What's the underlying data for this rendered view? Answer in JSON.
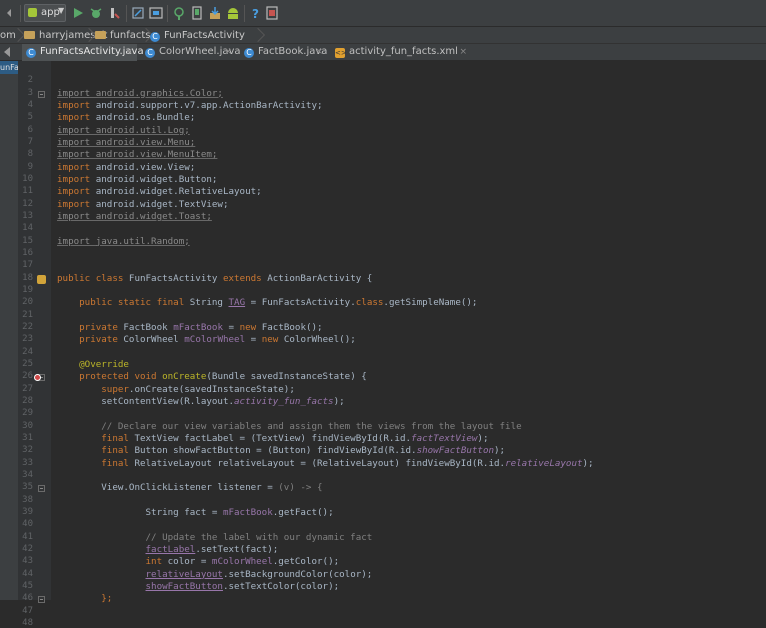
{
  "toolbar": {
    "run_config": "app",
    "icons": [
      "undo-icon",
      "redo-icon",
      "run-icon",
      "debug-icon",
      "stop-icon",
      "attach-debugger-icon",
      "sdk-manager-icon",
      "avd-manager-icon",
      "sync-icon",
      "gradle-icon",
      "android-icon",
      "help-icon",
      "device-monitor-icon"
    ]
  },
  "breadcrumb": {
    "items": [
      "om",
      "harryjamesuk",
      "funfacts",
      "FunFactsActivity"
    ]
  },
  "tabs": [
    {
      "label": "FunFactsActivity.java",
      "active": true,
      "type": "class"
    },
    {
      "label": "ColorWheel.java",
      "active": false,
      "type": "class"
    },
    {
      "label": "FactBook.java",
      "active": false,
      "type": "class"
    },
    {
      "label": "activity_fun_facts.xml",
      "active": false,
      "type": "xml"
    }
  ],
  "tab_close_label": "×",
  "left_strip": {
    "label": "unFa"
  },
  "editor": {
    "lines": [
      {
        "n": "",
        "segs": []
      },
      {
        "n": "2",
        "segs": []
      },
      {
        "n": "3",
        "segs": [
          {
            "t": "import android.graphics.Color;",
            "c": "imp"
          }
        ]
      },
      {
        "n": "4",
        "segs": [
          {
            "t": "import ",
            "c": "kw"
          },
          {
            "t": "android.support.v7.app.ActionBarActivity;",
            "c": ""
          }
        ]
      },
      {
        "n": "5",
        "segs": [
          {
            "t": "import ",
            "c": "kw"
          },
          {
            "t": "android.os.Bundle;",
            "c": ""
          }
        ]
      },
      {
        "n": "6",
        "segs": [
          {
            "t": "import android.util.Log;",
            "c": "imp"
          }
        ]
      },
      {
        "n": "7",
        "segs": [
          {
            "t": "import android.view.Menu;",
            "c": "imp"
          }
        ]
      },
      {
        "n": "8",
        "segs": [
          {
            "t": "import android.view.MenuItem;",
            "c": "imp"
          }
        ]
      },
      {
        "n": "9",
        "segs": [
          {
            "t": "import ",
            "c": "kw"
          },
          {
            "t": "android.view.View;",
            "c": ""
          }
        ]
      },
      {
        "n": "10",
        "segs": [
          {
            "t": "import ",
            "c": "kw"
          },
          {
            "t": "android.widget.Button;",
            "c": ""
          }
        ]
      },
      {
        "n": "11",
        "segs": [
          {
            "t": "import ",
            "c": "kw"
          },
          {
            "t": "android.widget.RelativeLayout;",
            "c": ""
          }
        ]
      },
      {
        "n": "12",
        "segs": [
          {
            "t": "import ",
            "c": "kw"
          },
          {
            "t": "android.widget.TextView;",
            "c": ""
          }
        ]
      },
      {
        "n": "13",
        "segs": [
          {
            "t": "import android.widget.Toast;",
            "c": "imp"
          }
        ]
      },
      {
        "n": "14",
        "segs": []
      },
      {
        "n": "15",
        "segs": [
          {
            "t": "import java.util.Random;",
            "c": "imp"
          }
        ]
      },
      {
        "n": "16",
        "segs": []
      },
      {
        "n": "17",
        "segs": []
      },
      {
        "n": "18",
        "segs": [
          {
            "t": "public class ",
            "c": "kw"
          },
          {
            "t": "FunFactsActivity ",
            "c": ""
          },
          {
            "t": "extends ",
            "c": "kw"
          },
          {
            "t": "ActionBarActivity {",
            "c": ""
          }
        ]
      },
      {
        "n": "19",
        "segs": []
      },
      {
        "n": "20",
        "segs": [
          {
            "t": "    public static final ",
            "c": "kw"
          },
          {
            "t": "String ",
            "c": ""
          },
          {
            "t": "TAG",
            "c": "ulfld"
          },
          {
            "t": " = FunFactsActivity.",
            "c": ""
          },
          {
            "t": "class",
            "c": "kw"
          },
          {
            "t": ".getSimpleName();",
            "c": ""
          }
        ]
      },
      {
        "n": "21",
        "segs": []
      },
      {
        "n": "22",
        "segs": [
          {
            "t": "    private ",
            "c": "kw"
          },
          {
            "t": "FactBook ",
            "c": ""
          },
          {
            "t": "mFactBook",
            "c": "fld"
          },
          {
            "t": " = ",
            "c": ""
          },
          {
            "t": "new ",
            "c": "kw"
          },
          {
            "t": "FactBook();",
            "c": ""
          }
        ]
      },
      {
        "n": "23",
        "segs": [
          {
            "t": "    private ",
            "c": "kw"
          },
          {
            "t": "ColorWheel ",
            "c": ""
          },
          {
            "t": "mColorWheel",
            "c": "fld"
          },
          {
            "t": " = ",
            "c": ""
          },
          {
            "t": "new ",
            "c": "kw"
          },
          {
            "t": "ColorWheel();",
            "c": ""
          }
        ]
      },
      {
        "n": "24",
        "segs": []
      },
      {
        "n": "25",
        "segs": [
          {
            "t": "    @Override",
            "c": "ann"
          }
        ]
      },
      {
        "n": "26",
        "segs": [
          {
            "t": "    protected void ",
            "c": "kw"
          },
          {
            "t": "onCreate",
            "c": "ann"
          },
          {
            "t": "(Bundle savedInstanceState) {",
            "c": ""
          }
        ]
      },
      {
        "n": "27",
        "segs": [
          {
            "t": "        super",
            "c": "kw"
          },
          {
            "t": ".onCreate(savedInstanceState);",
            "c": ""
          }
        ]
      },
      {
        "n": "28",
        "segs": [
          {
            "t": "        setContentView(R.layout.",
            "c": ""
          },
          {
            "t": "activity_fun_facts",
            "c": "ital"
          },
          {
            "t": ");",
            "c": ""
          }
        ]
      },
      {
        "n": "29",
        "segs": []
      },
      {
        "n": "30",
        "segs": [
          {
            "t": "        // Declare our view variables and assign them the views from the layout file",
            "c": "cmt"
          }
        ]
      },
      {
        "n": "31",
        "segs": [
          {
            "t": "        final ",
            "c": "kw"
          },
          {
            "t": "TextView factLabel = (TextView) findViewById(R.id.",
            "c": ""
          },
          {
            "t": "factTextView",
            "c": "ital"
          },
          {
            "t": ");",
            "c": ""
          }
        ]
      },
      {
        "n": "32",
        "segs": [
          {
            "t": "        final ",
            "c": "kw"
          },
          {
            "t": "Button showFactButton = (Button) findViewById(R.id.",
            "c": ""
          },
          {
            "t": "showFactButton",
            "c": "ital"
          },
          {
            "t": ");",
            "c": ""
          }
        ]
      },
      {
        "n": "33",
        "segs": [
          {
            "t": "        final ",
            "c": "kw"
          },
          {
            "t": "RelativeLayout relativeLayout = (RelativeLayout) findViewById(R.id.",
            "c": ""
          },
          {
            "t": "relativeLayout",
            "c": "ital"
          },
          {
            "t": ");",
            "c": ""
          }
        ]
      },
      {
        "n": "34",
        "segs": []
      },
      {
        "n": "35",
        "segs": [
          {
            "t": "        View.OnClickListener listener = ",
            "c": ""
          },
          {
            "t": "(v) -> {",
            "c": "grey"
          }
        ]
      },
      {
        "n": "38",
        "segs": []
      },
      {
        "n": "39",
        "segs": [
          {
            "t": "                String fact = ",
            "c": ""
          },
          {
            "t": "mFactBook",
            "c": "fld"
          },
          {
            "t": ".getFact();",
            "c": ""
          }
        ]
      },
      {
        "n": "40",
        "segs": []
      },
      {
        "n": "41",
        "segs": [
          {
            "t": "                // Update the label with our dynamic fact",
            "c": "cmt"
          }
        ]
      },
      {
        "n": "42",
        "segs": [
          {
            "t": "                ",
            "c": ""
          },
          {
            "t": "factLabel",
            "c": "ulfld"
          },
          {
            "t": ".setText(fact);",
            "c": ""
          }
        ]
      },
      {
        "n": "43",
        "segs": [
          {
            "t": "                int ",
            "c": "kw"
          },
          {
            "t": "color = ",
            "c": ""
          },
          {
            "t": "mColorWheel",
            "c": "fld"
          },
          {
            "t": ".getColor();",
            "c": ""
          }
        ]
      },
      {
        "n": "44",
        "segs": [
          {
            "t": "                ",
            "c": ""
          },
          {
            "t": "relativeLayout",
            "c": "ulfld"
          },
          {
            "t": ".setBackgroundColor(color);",
            "c": ""
          }
        ]
      },
      {
        "n": "45",
        "segs": [
          {
            "t": "                ",
            "c": ""
          },
          {
            "t": "showFactButton",
            "c": "ulfld"
          },
          {
            "t": ".setTextColor(color);",
            "c": ""
          }
        ]
      },
      {
        "n": "46",
        "segs": [
          {
            "t": "        };",
            "c": "kw"
          }
        ]
      },
      {
        "n": "47",
        "segs": []
      },
      {
        "n": "48",
        "segs": []
      }
    ]
  }
}
